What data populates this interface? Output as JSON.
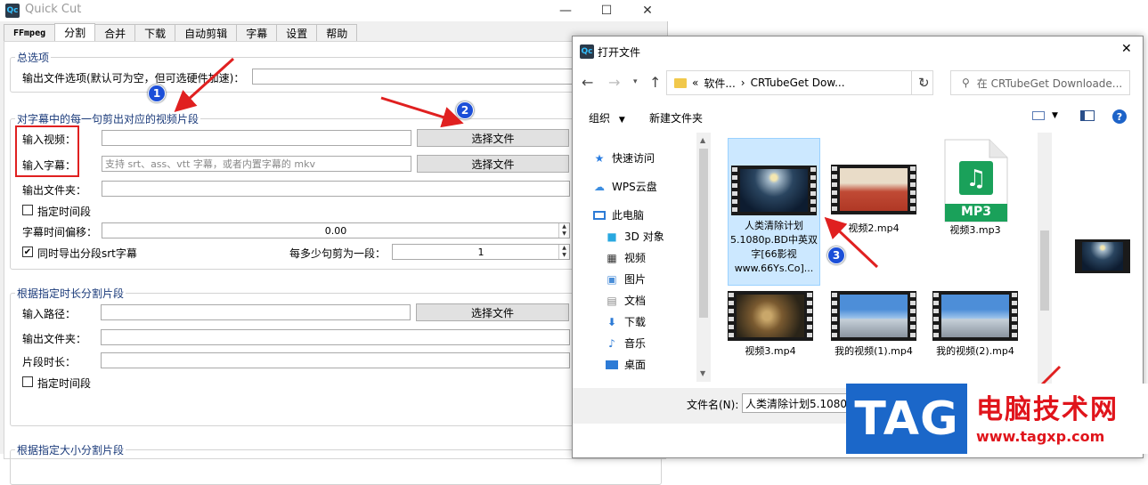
{
  "app": {
    "title": "Quick Cut",
    "logo_text": "Qc",
    "window_controls": {
      "minimize": "—",
      "maximize": "☐",
      "close": "✕"
    },
    "tabs": [
      "FFmpeg",
      "分割",
      "合并",
      "下载",
      "自动剪辑",
      "字幕",
      "设置",
      "帮助"
    ],
    "active_tab": "分割"
  },
  "general": {
    "title": "总选项",
    "output_options_label": "输出文件选项(默认可为空，但可选硬件加速)：",
    "output_options_value": ""
  },
  "subtitle_section": {
    "title": "对字幕中的每一句剪出对应的视频片段",
    "input_video_label": "输入视频：",
    "input_video_value": "",
    "input_subtitle_label": "输入字幕：",
    "input_subtitle_placeholder": "支持 srt、ass、vtt 字幕，或者内置字幕的 mkv",
    "output_folder_label": "输出文件夹：",
    "output_folder_value": "",
    "choose_file_1": "选择文件",
    "choose_file_2": "选择文件",
    "time_range_label": "指定时间段",
    "time_range_checked": false,
    "offset_label": "字幕时间偏移：",
    "offset_value": "0.00",
    "export_srt_label": "同时导出分段srt字幕",
    "export_srt_checked": true,
    "per_segment_label": "每多少句剪为一段：",
    "per_segment_value": "1"
  },
  "duration_section": {
    "title": "根据指定时长分割片段",
    "input_path_label": "输入路径：",
    "input_path_value": "",
    "choose_file": "选择文件",
    "output_folder_label": "输出文件夹：",
    "output_folder_value": "",
    "segment_length_label": "片段时长：",
    "segment_length_value": "",
    "time_range_label": "指定时间段",
    "time_range_checked": false
  },
  "size_section": {
    "title": "根据指定大小分割片段"
  },
  "annotations": {
    "badge1": "1",
    "badge2": "2",
    "badge3": "3"
  },
  "dialog": {
    "logo_text": "Qc",
    "title": "打开文件",
    "close": "✕",
    "breadcrumb_prefix": "«",
    "breadcrumb_1": "软件...",
    "breadcrumb_sep": "›",
    "breadcrumb_2": "CRTubeGet Dow...",
    "search_placeholder": "在 CRTubeGet Downloade...",
    "organize_label": "组织",
    "new_folder_label": "新建文件夹",
    "nav_items": [
      "快速访问",
      "WPS云盘",
      "此电脑",
      "3D 对象",
      "视频",
      "图片",
      "文档",
      "下载",
      "音乐",
      "桌面"
    ],
    "files": [
      {
        "name": "人类清除计划5.1080p.BD中英双字[66影视www.66Ys.Co]...",
        "type": "video",
        "selected": true
      },
      {
        "name": "视频2.mp4",
        "type": "video",
        "selected": false
      },
      {
        "name": "视频3.mp3",
        "type": "audio",
        "selected": false
      },
      {
        "name": "视频3.mp4",
        "type": "video",
        "selected": false
      },
      {
        "name": "我的视频(1).mp4",
        "type": "video",
        "selected": false
      },
      {
        "name": "我的视频(2).mp4",
        "type": "video",
        "selected": false
      }
    ],
    "mp3_badge": "MP3",
    "filename_label": "文件名(N):",
    "filename_value": "人类清除计划5.1080p."
  },
  "watermark": {
    "tag": "TAG",
    "title": "电脑技术网",
    "url": "www.tagxp.com"
  },
  "colors": {
    "accent_blue": "#1c4fd8",
    "annotation_red": "#e02020",
    "selection": "#cce8ff",
    "watermark_blue": "#1b67c9",
    "watermark_red": "#e0141b"
  }
}
